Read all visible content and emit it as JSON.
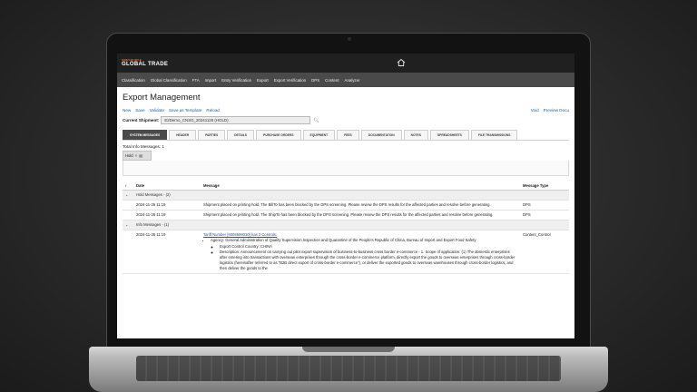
{
  "header": {
    "brand_small": "ONESOURCE",
    "brand_big": "GLOBAL TRADE"
  },
  "nav": [
    "Classification",
    "Global Classification",
    "FTA",
    "Import",
    "Entry Verification",
    "Export",
    "Export Verification",
    "DPS",
    "Content",
    "Analyzer"
  ],
  "page": {
    "title": "Export Management",
    "actions": [
      "New",
      "Save",
      "Validate",
      "Save as Template",
      "Reload"
    ],
    "right_actions": [
      "Void",
      "Preview Docu"
    ],
    "current_shipment_label": "Current Shipment:",
    "current_shipment_value": "E2Demo_CNSG_20241126 (HOLD)"
  },
  "tabs": [
    "SYSTEM MESSAGES",
    "HEADER",
    "PARTIES",
    "DETAILS",
    "PURCHASE ORDERS",
    "EQUIPMENT",
    "FEES",
    "DOCUMENTATION",
    "NOTES",
    "SPREADSHEETS",
    "FILE TRANSMISSIONS"
  ],
  "messages": {
    "total_label": "Total Info Messages: 1",
    "filter_chip": "Hold",
    "columns": {
      "date": "Date",
      "message": "Message",
      "type": "Message Type"
    },
    "hold_group": "Hold Messages - (2)",
    "hold_rows": [
      {
        "date": "2024-11-26 11:19",
        "message": "Shipment placed on printing hold. The BillTo has been blocked by the DPS screening. Please review the DPS results for the affected parties and resolve before generating.",
        "type": "DPS"
      },
      {
        "date": "2024-11-26 11:19",
        "message": "Shipment placed on printing hold. The ShipTo has been blocked by the DPS screening. Please review the DPS results for the affected parties and resolve before generating.",
        "type": "DPS"
      }
    ],
    "info_group": "Info Messages - (1)",
    "info_row": {
      "date": "2024-11-26 11:19",
      "link": "Tariff Number [9008599010] has 2 Controls:",
      "agency": "Agency: General Administration of Quality Supervision,Inspection and Quarantine of the People's Republic of China, Bureau of Import and Export Food Safety",
      "country": "Export Control Country: CHINA",
      "description": "Description: Announcement on carrying out pilot export supervision of business-to-business cross border e-commerce - 1. Scope of application: (1) The domestic enterprises after entering into transactions with overseas enterprises through the cross-border e-commerce platform, directly export the goods to overseas enterprises through cross-border logistics (hereinafter referred to as \"B2B direct export of cross-border e-commerce\"), or deliver the exported goods to overseas warehouses through cross-border logistics, and then deliver the goods to the",
      "type": "Content_Control"
    }
  }
}
